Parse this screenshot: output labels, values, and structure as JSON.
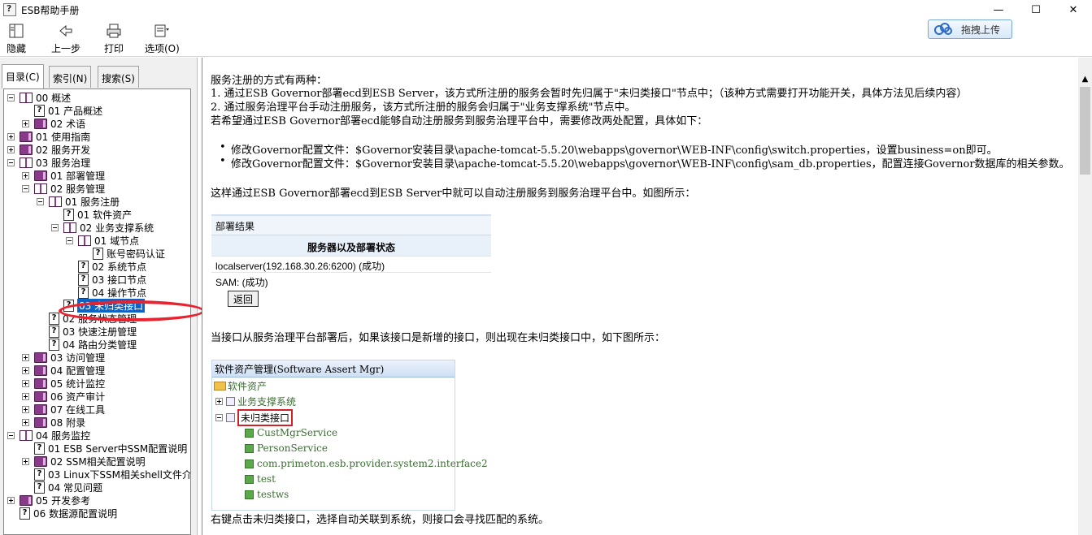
{
  "window": {
    "title": "ESB帮助手册",
    "controls": [
      "—",
      "☐",
      "✕"
    ]
  },
  "toolbar": {
    "buttons": [
      {
        "label": "隐藏",
        "icon": "hide-pane-icon"
      },
      {
        "label": "上一步",
        "icon": "back-arrow-icon"
      },
      {
        "label": "打印",
        "icon": "printer-icon"
      },
      {
        "label": "选项(O)",
        "icon": "options-icon"
      }
    ],
    "upload_label": "拖拽上传"
  },
  "tabs": [
    {
      "label": "目录(C)",
      "active": true
    },
    {
      "label": "索引(N)",
      "active": false
    },
    {
      "label": "搜索(S)",
      "active": false
    }
  ],
  "tree": [
    {
      "label": "00 概述",
      "type": "book-open",
      "level": 0,
      "exp": "minus"
    },
    {
      "label": "01 产品概述",
      "type": "page",
      "level": 1
    },
    {
      "label": "02 术语",
      "type": "book-closed",
      "level": 1,
      "exp": "plus"
    },
    {
      "label": "01 使用指南",
      "type": "book-closed",
      "level": 0,
      "exp": "plus"
    },
    {
      "label": "02 服务开发",
      "type": "book-closed",
      "level": 0,
      "exp": "plus"
    },
    {
      "label": "03 服务治理",
      "type": "book-open",
      "level": 0,
      "exp": "minus"
    },
    {
      "label": "01 部署管理",
      "type": "book-closed",
      "level": 1,
      "exp": "plus"
    },
    {
      "label": "02 服务管理",
      "type": "book-open",
      "level": 1,
      "exp": "minus"
    },
    {
      "label": "01 服务注册",
      "type": "book-open",
      "level": 2,
      "exp": "minus"
    },
    {
      "label": "01 软件资产",
      "type": "page",
      "level": 3
    },
    {
      "label": "02 业务支撑系统",
      "type": "book-open",
      "level": 3,
      "exp": "minus"
    },
    {
      "label": "01 域节点",
      "type": "book-open",
      "level": 4,
      "exp": "minus"
    },
    {
      "label": "账号密码认证",
      "type": "page",
      "level": 5
    },
    {
      "label": "02 系统节点",
      "type": "page",
      "level": 4
    },
    {
      "label": "03 接口节点",
      "type": "page",
      "level": 4
    },
    {
      "label": "04 操作节点",
      "type": "page",
      "level": 4
    },
    {
      "label": "03 未归类接口",
      "type": "page",
      "level": 3,
      "selected": true
    },
    {
      "label": "02 服务状态管理",
      "type": "page",
      "level": 2
    },
    {
      "label": "03 快速注册管理",
      "type": "page",
      "level": 2
    },
    {
      "label": "04 路由分类管理",
      "type": "page",
      "level": 2
    },
    {
      "label": "03 访问管理",
      "type": "book-closed",
      "level": 1,
      "exp": "plus"
    },
    {
      "label": "04 配置管理",
      "type": "book-closed",
      "level": 1,
      "exp": "plus"
    },
    {
      "label": "05 统计监控",
      "type": "book-closed",
      "level": 1,
      "exp": "plus"
    },
    {
      "label": "06 资产审计",
      "type": "book-closed",
      "level": 1,
      "exp": "plus"
    },
    {
      "label": "07 在线工具",
      "type": "book-closed",
      "level": 1,
      "exp": "plus"
    },
    {
      "label": "08 附录",
      "type": "book-closed",
      "level": 1,
      "exp": "plus"
    },
    {
      "label": "04 服务监控",
      "type": "book-open",
      "level": 0,
      "exp": "minus"
    },
    {
      "label": "01 ESB Server中SSM配置说明",
      "type": "page",
      "level": 1
    },
    {
      "label": "02 SSM相关配置说明",
      "type": "book-closed",
      "level": 1,
      "exp": "plus"
    },
    {
      "label": "03 Linux下SSM相关shell文件介",
      "type": "page",
      "level": 1
    },
    {
      "label": "04 常见问题",
      "type": "page",
      "level": 1
    },
    {
      "label": "05 开发参考",
      "type": "book-closed",
      "level": 0,
      "exp": "plus"
    },
    {
      "label": "06 数据源配置说明",
      "type": "page",
      "level": 0
    }
  ],
  "content": {
    "p1": "服务注册的方式有两种：",
    "p2": "1. 通过ESB Governor部署ecd到ESB Server，该方式所注册的服务会暂时先归属于\"未归类接口\"节点中；（该种方式需要打开功能开关，具体方法见后续内容）",
    "p3": "2. 通过服务治理平台手动注册服务，该方式所注册的服务会归属于\"业务支撑系统\"节点中。",
    "p4": "若希望通过ESB Governor部署ecd能够自动注册服务到服务治理平台中，需要修改两处配置，具体如下：",
    "b1": "修改Governor配置文件：$Governor安装目录\\apache-tomcat-5.5.20\\webapps\\governor\\WEB-INF\\config\\switch.properties，设置business=on即可。",
    "b2": "修改Governor配置文件：$Governor安装目录\\apache-tomcat-5.5.20\\webapps\\governor\\WEB-INF\\config\\sam_db.properties，配置连接Governor数据库的相关参数。",
    "p5": "这样通过ESB Governor部署ecd到ESB Server中就可以自动注册服务到服务治理平台中。如图所示：",
    "p6": "当接口从服务治理平台部署后，如果该接口是新增的接口，则出现在未归类接口中，如下图所示：",
    "p7": "右键点击未归类接口，选择自动关联到系统，则接口会寻找匹配的系统。"
  },
  "figure1": {
    "header": "部署结果",
    "column_header": "服务器以及部署状态",
    "rows": [
      "localserver(192.168.30.26:6200) (成功)",
      "SAM: (成功)"
    ],
    "button": "返回"
  },
  "figure2": {
    "header": "软件资产管理(Software Assert Mgr)",
    "root": "软件资产",
    "node1": "业务支撑系统",
    "node2": "未归类接口",
    "services": [
      "CustMgrService",
      "PersonService",
      "com.primeton.esb.provider.system2.interface2",
      "test",
      "testws"
    ]
  }
}
